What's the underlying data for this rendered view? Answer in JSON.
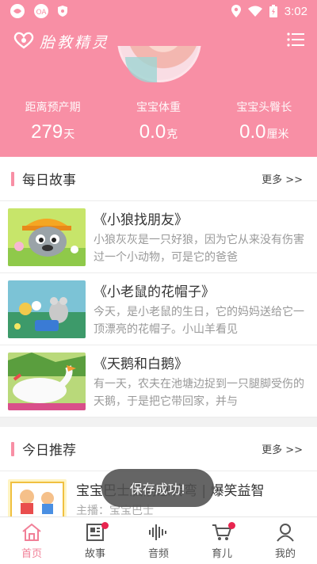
{
  "status_bar": {
    "time": "3:02"
  },
  "app": {
    "title": "胎教精灵"
  },
  "stats": [
    {
      "label": "距离预产期",
      "value": "279",
      "unit": "天"
    },
    {
      "label": "宝宝体重",
      "value": "0.0",
      "unit": "克"
    },
    {
      "label": "宝宝头臀长",
      "value": "0.0",
      "unit": "厘米"
    }
  ],
  "daily_story": {
    "title": "每日故事",
    "more": "更多 >>",
    "items": [
      {
        "title": "《小狼找朋友》",
        "desc": "小狼灰灰是一只好狼，因为它从来没有伤害过一个小动物，可是它的爸爸"
      },
      {
        "title": "《小老鼠的花帽子》",
        "desc": "今天，是小老鼠的生日，它的妈妈送给它一顶漂亮的花帽子。小山羊看见"
      },
      {
        "title": "《天鹅和白鹅》",
        "desc": "有一天，农夫在池塘边捉到一只腿脚受伤的天鹅，于是把它带回家，并与"
      }
    ]
  },
  "today_rec": {
    "title": "今日推荐",
    "more": "更多 >>",
    "item": {
      "title": "宝宝巴士脑筋急转弯 | 爆笑益智",
      "sub": "主播：宝宝巴士"
    }
  },
  "toast": "保存成功!",
  "tabs": [
    {
      "label": "首页",
      "icon": "home-icon",
      "active": true
    },
    {
      "label": "故事",
      "icon": "book-icon",
      "badge": true
    },
    {
      "label": "音频",
      "icon": "waveform-icon"
    },
    {
      "label": "育儿",
      "icon": "cart-icon",
      "badge": true
    },
    {
      "label": "我的",
      "icon": "user-icon"
    }
  ],
  "colors": {
    "primary": "#f88fa5",
    "tab_active": "#f17f97",
    "badge": "#e8254f"
  }
}
